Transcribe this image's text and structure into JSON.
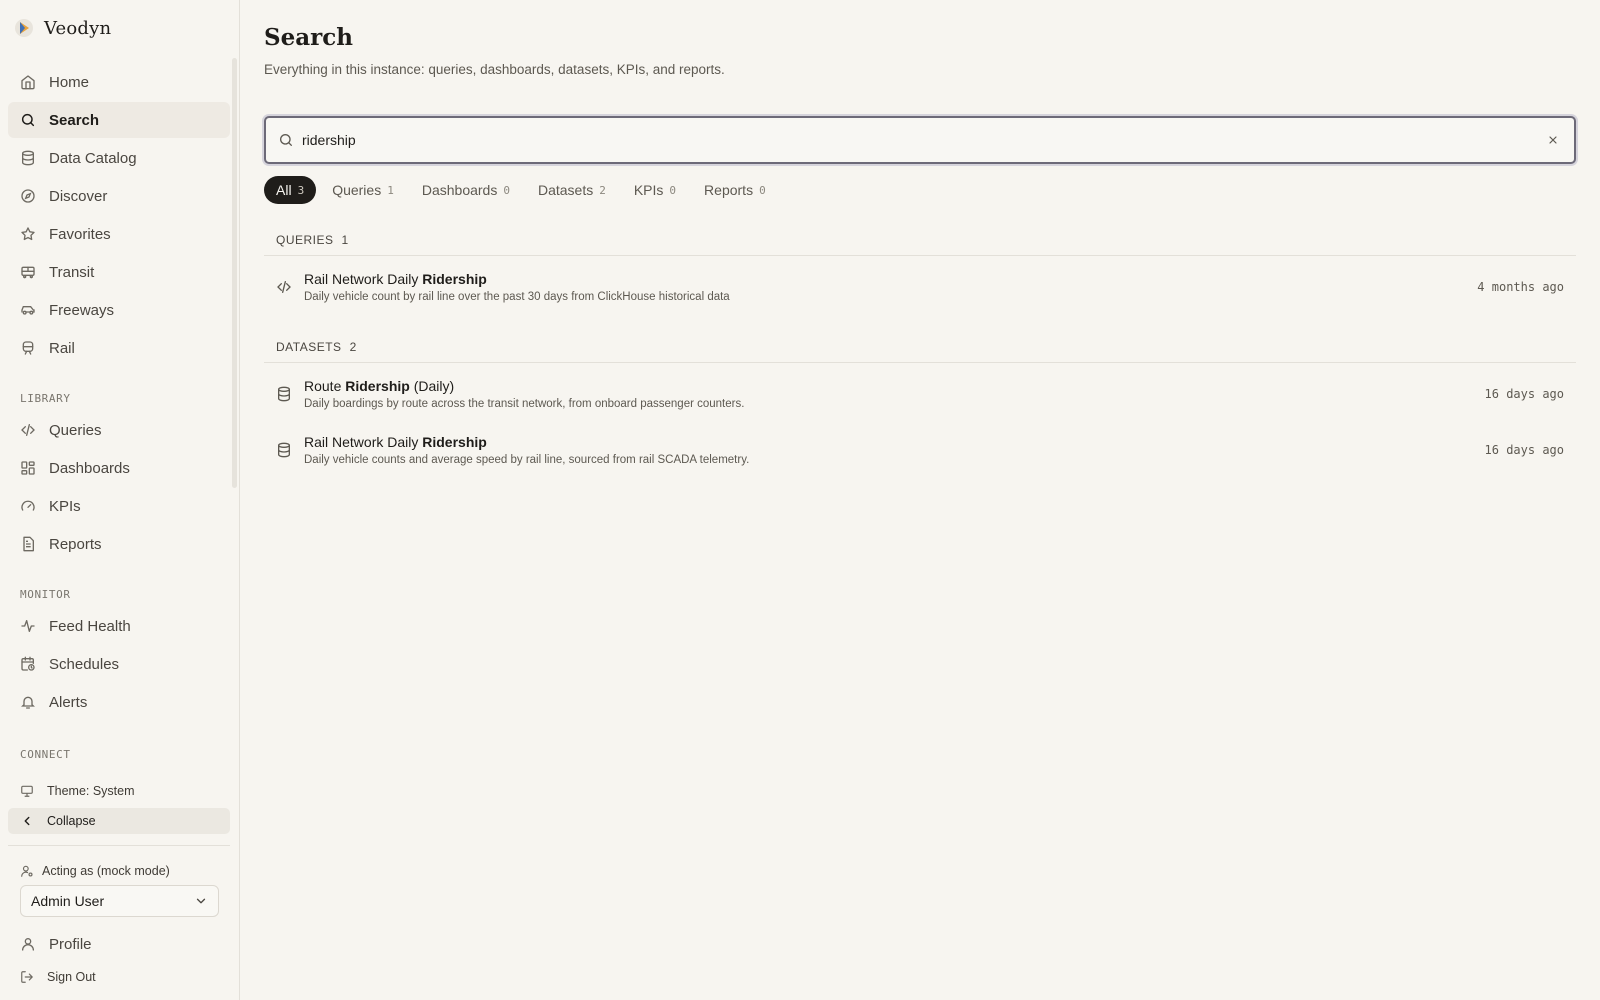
{
  "app": {
    "name": "Veodyn"
  },
  "sidebar": {
    "main_items": [
      {
        "label": "Home",
        "icon": "home-icon"
      },
      {
        "label": "Search",
        "icon": "search-icon",
        "active": true
      },
      {
        "label": "Data Catalog",
        "icon": "database-icon"
      },
      {
        "label": "Discover",
        "icon": "compass-icon"
      },
      {
        "label": "Favorites",
        "icon": "star-icon"
      },
      {
        "label": "Transit",
        "icon": "bus-icon"
      },
      {
        "label": "Freeways",
        "icon": "car-icon"
      },
      {
        "label": "Rail",
        "icon": "train-icon"
      }
    ],
    "library_label": "LIBRARY",
    "library_items": [
      {
        "label": "Queries",
        "icon": "code-icon"
      },
      {
        "label": "Dashboards",
        "icon": "dashboard-icon"
      },
      {
        "label": "KPIs",
        "icon": "gauge-icon"
      },
      {
        "label": "Reports",
        "icon": "file-icon"
      }
    ],
    "monitor_label": "MONITOR",
    "monitor_items": [
      {
        "label": "Feed Health",
        "icon": "activity-icon"
      },
      {
        "label": "Schedules",
        "icon": "calendar-clock-icon"
      },
      {
        "label": "Alerts",
        "icon": "bell-icon"
      }
    ],
    "connect_label": "CONNECT",
    "theme_label": "Theme: System",
    "collapse_label": "Collapse",
    "acting_as_label": "Acting as (mock mode)",
    "user_selected": "Admin User",
    "profile_label": "Profile",
    "signout_label": "Sign Out"
  },
  "main": {
    "title": "Search",
    "subtitle": "Everything in this instance: queries, dashboards, datasets, KPIs, and reports.",
    "search_value": "ridership",
    "tabs": [
      {
        "label": "All",
        "count": "3",
        "active": true
      },
      {
        "label": "Queries",
        "count": "1"
      },
      {
        "label": "Dashboards",
        "count": "0"
      },
      {
        "label": "Datasets",
        "count": "2"
      },
      {
        "label": "KPIs",
        "count": "0"
      },
      {
        "label": "Reports",
        "count": "0"
      }
    ],
    "groups": [
      {
        "label": "QUERIES",
        "count": "1",
        "results": [
          {
            "title_pre": "Rail Network Daily ",
            "title_match": "Ridership",
            "title_post": "",
            "desc": "Daily vehicle count by rail line over the past 30 days from ClickHouse historical data",
            "time": "4 months ago",
            "icon": "code-icon"
          }
        ]
      },
      {
        "label": "DATASETS",
        "count": "2",
        "results": [
          {
            "title_pre": "Route ",
            "title_match": "Ridership",
            "title_post": " (Daily)",
            "desc": "Daily boardings by route across the transit network, from onboard passenger counters.",
            "time": "16 days ago",
            "icon": "database-icon"
          },
          {
            "title_pre": "Rail Network Daily ",
            "title_match": "Ridership",
            "title_post": "",
            "desc": "Daily vehicle counts and average speed by rail line, sourced from rail SCADA telemetry.",
            "time": "16 days ago",
            "icon": "database-icon"
          }
        ]
      }
    ]
  }
}
